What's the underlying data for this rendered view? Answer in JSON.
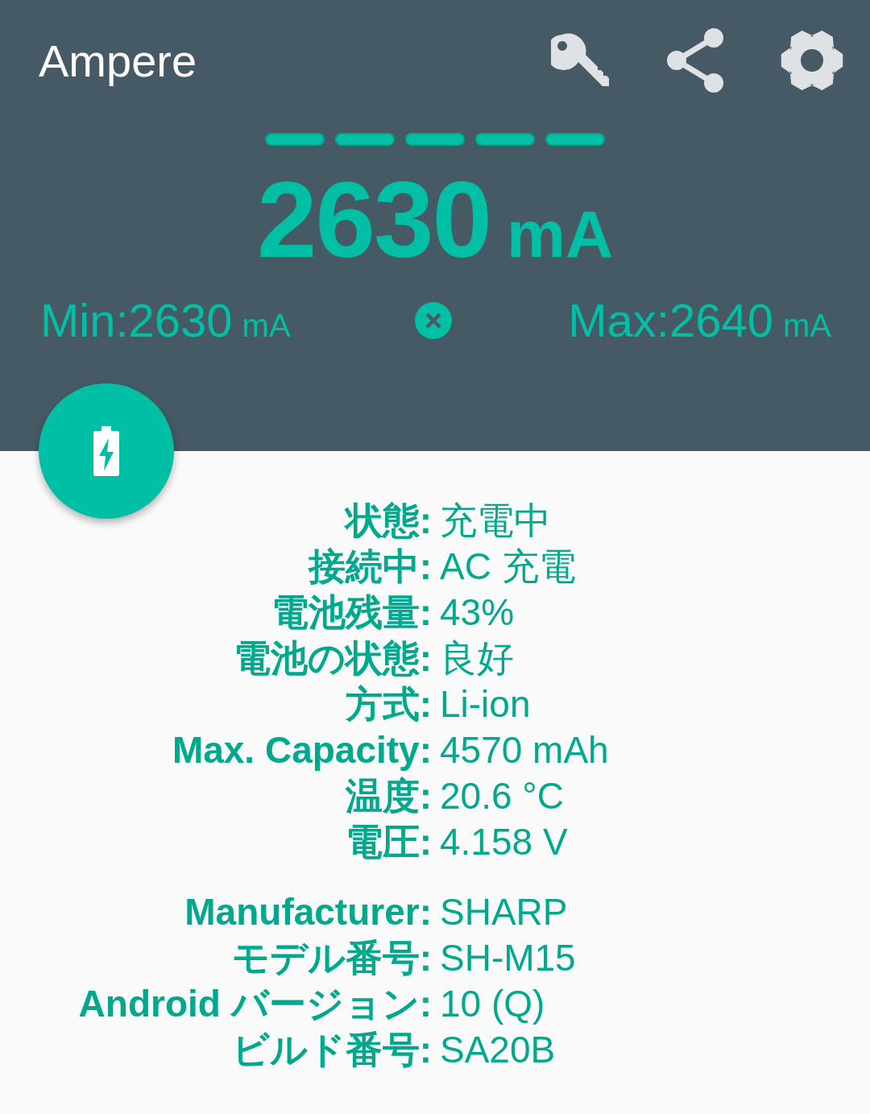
{
  "app_bar": {
    "title": "Ampere"
  },
  "current": {
    "value": "2630",
    "unit": "mA"
  },
  "min": {
    "label": "Min:",
    "value": "2630",
    "unit": "mA"
  },
  "max": {
    "label": "Max:",
    "value": "2640",
    "unit": "mA"
  },
  "info_groups": [
    [
      {
        "label": "状態:",
        "value": "充電中"
      },
      {
        "label": "接続中:",
        "value": "AC 充電"
      },
      {
        "label": "電池残量:",
        "value": "43%"
      },
      {
        "label": "電池の状態:",
        "value": "良好"
      },
      {
        "label": "方式:",
        "value": "Li-ion"
      },
      {
        "label": "Max. Capacity:",
        "value": "4570 mAh"
      },
      {
        "label": "温度:",
        "value": "20.6 °C"
      },
      {
        "label": "電圧:",
        "value": "4.158 V"
      }
    ],
    [
      {
        "label": "Manufacturer:",
        "value": "SHARP"
      },
      {
        "label": "モデル番号:",
        "value": "SH-M15"
      },
      {
        "label": "Android バージョン:",
        "value": "10 (Q)"
      },
      {
        "label": "ビルド番号:",
        "value": "SA20B"
      }
    ]
  ]
}
